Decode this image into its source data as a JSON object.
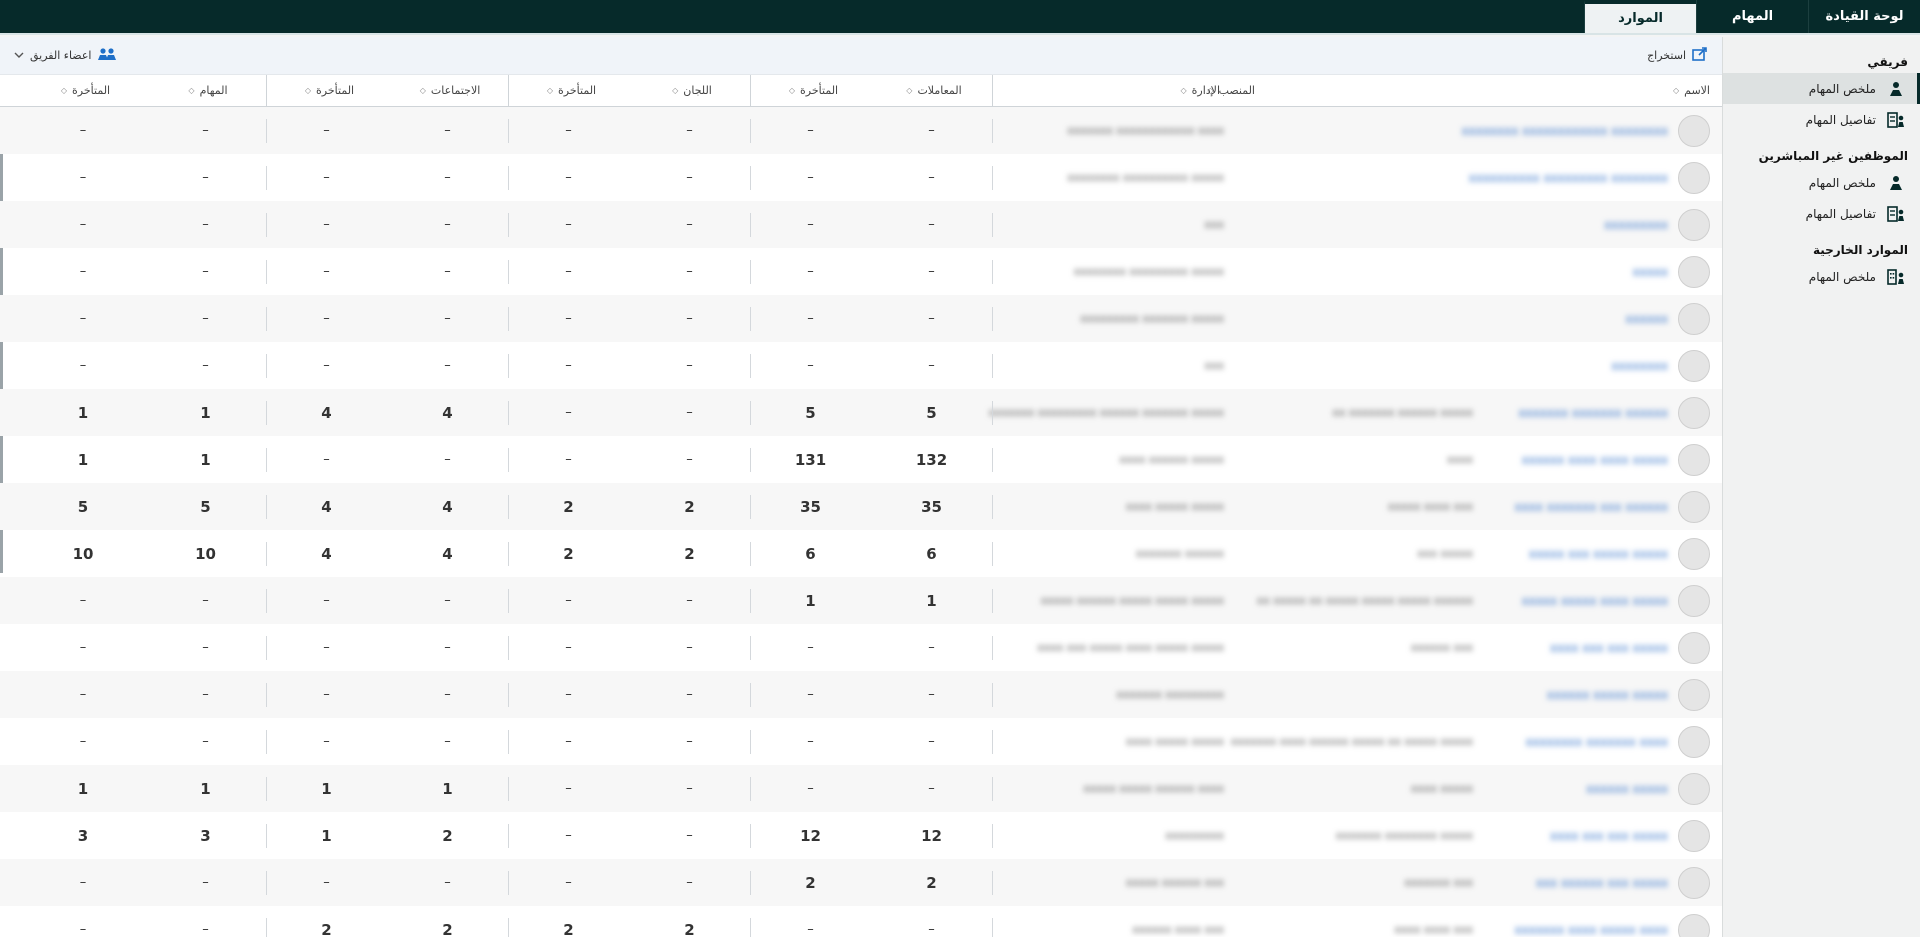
{
  "topnav": {
    "tabs": [
      {
        "label": "لوحة القيادة"
      },
      {
        "label": "المهام"
      },
      {
        "label": "الموارد"
      }
    ]
  },
  "sidebar": {
    "sections": [
      {
        "title": "فريقي",
        "items": [
          {
            "label": "ملخص المهام"
          },
          {
            "label": "تفاصيل المهام"
          }
        ]
      },
      {
        "title": "الموظفين غير المباشرين",
        "items": [
          {
            "label": "ملخص المهام"
          },
          {
            "label": "تفاصيل المهام"
          }
        ]
      },
      {
        "title": "الموارد الخارجية",
        "items": [
          {
            "label": "ملخص المهام"
          }
        ]
      }
    ]
  },
  "toolbar": {
    "export_label": "استخراج",
    "team_members_label": "اعضاء الفريق"
  },
  "table": {
    "headers": {
      "name": "الاسم",
      "position": "المنصب",
      "department": "الإدارة",
      "transactions": "المعاملات",
      "late1": "المتأخرة",
      "committees": "اللجان",
      "late2": "المتأخرة",
      "meetings": "الاجتماعات",
      "late3": "المتأخرة",
      "tasks": "المهام",
      "late4": "المتأخرة"
    },
    "rows": [
      {
        "name": "xxxxxxxx xxxxxxxxxxxx xxxxxxxx",
        "position": "",
        "department": "xxxxxxx xxxxxxxxxxxx xxxx",
        "v": [
          "–",
          "–",
          "–",
          "–",
          "–",
          "–",
          "–",
          "–"
        ]
      },
      {
        "name": "xxxxxxxxxx xxxxxxxxx xxxxxxxx",
        "position": "",
        "department": "xxxxxxxx xxxxxxxxxx xxxxx",
        "v": [
          "–",
          "–",
          "–",
          "–",
          "–",
          "–",
          "–",
          "–"
        ]
      },
      {
        "name": "xxxxxxxxx",
        "position": "",
        "department": "xxx",
        "v": [
          "–",
          "–",
          "–",
          "–",
          "–",
          "–",
          "–",
          "–"
        ]
      },
      {
        "name": "xxxxx",
        "position": "",
        "department": "xxxxxxxx xxxxxxxxx xxxxx",
        "v": [
          "–",
          "–",
          "–",
          "–",
          "–",
          "–",
          "–",
          "–"
        ]
      },
      {
        "name": "xxxxxx",
        "position": "",
        "department": "xxxxxxxxx xxxxxxx xxxxx",
        "v": [
          "–",
          "–",
          "–",
          "–",
          "–",
          "–",
          "–",
          "–"
        ]
      },
      {
        "name": "xxxxxxxx",
        "position": "",
        "department": "xxx",
        "v": [
          "–",
          "–",
          "–",
          "–",
          "–",
          "–",
          "–",
          "–"
        ]
      },
      {
        "name": "xxxxxxx xxxxxxx xxxxxx",
        "position": "xx xxxxxxx xxxxxx xxxxx",
        "department": "xxxxxxx xxxxxxxxx xxxxxx xxxxxxx xxxxx",
        "v": [
          "5",
          "5",
          "–",
          "–",
          "4",
          "4",
          "1",
          "1"
        ]
      },
      {
        "name": "xxxxxx xxxx xxxx xxxxx",
        "position": "xxxx",
        "department": "xxxx xxxxxx xxxxx",
        "v": [
          "132",
          "131",
          "–",
          "–",
          "–",
          "–",
          "1",
          "1"
        ]
      },
      {
        "name": "xxxx xxxxxxx xxx xxxxxx",
        "position": "xxxxx xxxx xxx",
        "department": "xxxx xxxxx xxxxx",
        "v": [
          "35",
          "35",
          "2",
          "2",
          "4",
          "4",
          "5",
          "5"
        ]
      },
      {
        "name": "xxxxx xxx xxxxx xxxxx",
        "position": "xxx xxxxx",
        "department": "xxxxxxx xxxxxx",
        "v": [
          "6",
          "6",
          "2",
          "2",
          "4",
          "4",
          "10",
          "10"
        ]
      },
      {
        "name": "xxxxx xxxxx xxxx xxxxx",
        "position": "xx xxxxx xx xxxxx xxxxx xxxxx xxxxxx",
        "department": "xxxxx xxxxxx xxxxx xxxxx xxxxx",
        "v": [
          "1",
          "1",
          "–",
          "–",
          "–",
          "–",
          "–",
          "–"
        ]
      },
      {
        "name": "xxxx xxx xxx xxxxx",
        "position": "xxxxxx xxx",
        "department": "xxxx xxx xxxxx xxxx xxxxx xxxxx",
        "v": [
          "–",
          "–",
          "–",
          "–",
          "–",
          "–",
          "–",
          "–"
        ]
      },
      {
        "name": "xxxxxx xxxxx xxxxx",
        "position": "",
        "department": "xxxxxxx xxxxxxxxx",
        "v": [
          "–",
          "–",
          "–",
          "–",
          "–",
          "–",
          "–",
          "–"
        ]
      },
      {
        "name": "xxxxxxxx xxxxxxx xxxx",
        "position": "xxxxxxx xxxx xxxxxx xxxxx xx xxxxx xxxxx",
        "department": "xxxx xxxxx xxxxx",
        "v": [
          "–",
          "–",
          "–",
          "–",
          "–",
          "–",
          "–",
          "–"
        ]
      },
      {
        "name": "xxxxxx xxxxx",
        "position": "xxxx xxxxx",
        "department": "xxxxx xxxxx xxxxxx xxxx",
        "v": [
          "–",
          "–",
          "–",
          "–",
          "1",
          "1",
          "1",
          "1"
        ]
      },
      {
        "name": "xxxx xxx xxx xxxxx",
        "position": "xxxxxxx xxxxxxxx xxxxx",
        "department": "xxxxxxxxx",
        "v": [
          "12",
          "12",
          "–",
          "–",
          "2",
          "1",
          "3",
          "3"
        ]
      },
      {
        "name": "xxx xxxxxx xxx xxxxx",
        "position": "xxxxxxx xxx",
        "department": "xxxxx xxxxxx xxx",
        "v": [
          "2",
          "2",
          "–",
          "–",
          "–",
          "–",
          "–",
          "–"
        ]
      },
      {
        "name": "xxxxxxx xxxx xxxxx xxxx",
        "position": "xxxx xxxx xxx",
        "department": "xxxxxx xxxx xxx",
        "v": [
          "–",
          "–",
          "2",
          "2",
          "2",
          "2",
          "–",
          "–"
        ]
      }
    ]
  }
}
